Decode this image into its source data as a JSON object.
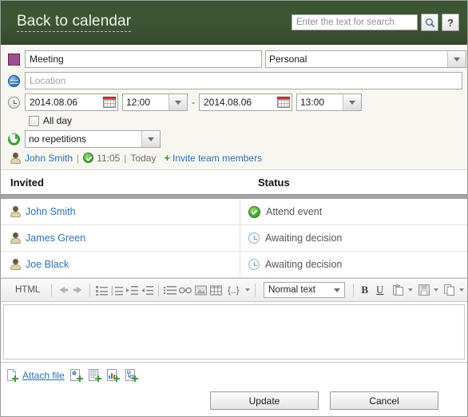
{
  "header": {
    "back_label": "Back to calendar",
    "search_placeholder": "Enter the text for search",
    "search_value": "",
    "search_icon": "search-icon",
    "help_label": "?",
    "bg_color": "#3a5332"
  },
  "form": {
    "color_swatch": "#9e4f8e",
    "title_value": "Meeting",
    "title_placeholder": "",
    "category_value": "Personal",
    "location_value": "",
    "location_placeholder": "Location",
    "start_date": "2014.08.06",
    "start_time": "12:00",
    "range_separator": "-",
    "end_date": "2014.08.06",
    "end_time": "13:00",
    "all_day_label": "All day",
    "all_day_checked": false,
    "repeat_value": "no repetitions",
    "author_name": "John Smith",
    "author_time": "11:05",
    "author_day": "Today",
    "invite_label": "Invite team members",
    "invite_plus": "+"
  },
  "table": {
    "columns": [
      "Invited",
      "Status"
    ],
    "rows": [
      {
        "name": "John Smith",
        "status": "Attend event",
        "status_icon": "check-circle-icon"
      },
      {
        "name": "James Green",
        "status": "Awaiting decision",
        "status_icon": "clock-icon"
      },
      {
        "name": "Joe Black",
        "status": "Awaiting decision",
        "status_icon": "clock-icon"
      }
    ]
  },
  "editor": {
    "html_label": "HTML",
    "style_value": "Normal text",
    "bold_label": "B",
    "underline_label": "U",
    "placeholder_label": "{..}",
    "body_value": "",
    "tools": [
      "undo-icon",
      "redo-icon",
      "bullet-list-icon",
      "numbered-list-icon",
      "indent-icon",
      "outdent-icon",
      "insert-list-item-icon",
      "link-icon",
      "image-icon",
      "table-icon",
      "placeholder-icon",
      "bold-icon",
      "underline-icon",
      "paste-icon",
      "save-icon",
      "copy-icon"
    ]
  },
  "footer": {
    "attach_label": "Attach file",
    "attach_icons": [
      "add-media-icon",
      "add-document-icon",
      "add-chart-icon",
      "add-diagram-icon"
    ],
    "update_label": "Update",
    "cancel_label": "Cancel"
  }
}
